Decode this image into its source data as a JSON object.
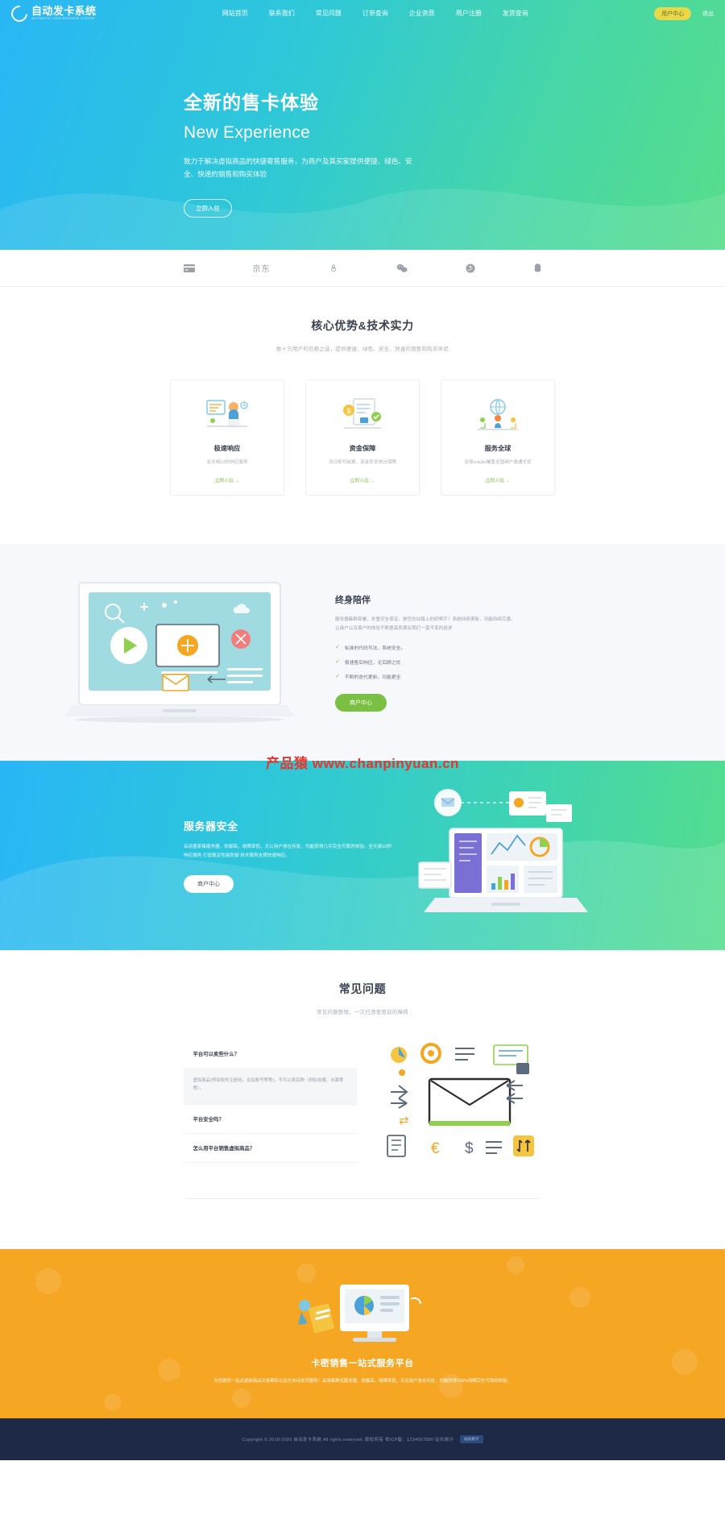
{
  "brand_colors": {
    "hero_start": "#29b6f6",
    "hero_end": "#57dd8a",
    "green": "#7ac143",
    "orange": "#f5a623",
    "footer": "#1e2a45",
    "user_btn": "#e9d84a",
    "watermark": "#e8342a"
  },
  "header": {
    "logo_title": "自动发卡系统",
    "logo_sub": "AUTOMATIC CARD BUSINESS SYSTEM",
    "nav": [
      {
        "label": "网站首页"
      },
      {
        "label": "联系我们"
      },
      {
        "label": "常见问题"
      },
      {
        "label": "订单查询"
      },
      {
        "label": "企业资质"
      },
      {
        "label": "用户注册"
      },
      {
        "label": "发货查询"
      }
    ],
    "user_center": "用户中心",
    "logout": "退出"
  },
  "hero": {
    "title_cn": "全新的售卡体验",
    "title_en": "New Experience",
    "desc": "致力于解决虚拟商品的快捷寄售服务，为商户及其买家提供便捷、绿色、安全、快速的销售和购买体验",
    "button": "立即入驻"
  },
  "brands": [
    {
      "name": "card-icon",
      "label": ""
    },
    {
      "name": "jd-logo",
      "label": "京东"
    },
    {
      "name": "taobao-icon",
      "label": ""
    },
    {
      "name": "wechat-icon",
      "label": ""
    },
    {
      "name": "alipay-icon",
      "label": ""
    },
    {
      "name": "qq-icon",
      "label": ""
    }
  ],
  "advantages": {
    "title": "核心优势&技术实力",
    "subtitle": "数十万用户的信赖之选，提供便捷、绿色、安全、快速的销售和购买体验",
    "cards": [
      {
        "title": "极速响应",
        "desc": "全天候10秒响应服务",
        "link": "立即入驻 →"
      },
      {
        "title": "资金保障",
        "desc": "次日即可结算，资金安全充分保障",
        "link": "立即入驻 →"
      },
      {
        "title": "服务全球",
        "desc": "全球ização覆盖全国用户速通无忧",
        "link": "立即入驻 →"
      }
    ]
  },
  "companion": {
    "title": "终身陪伴",
    "desc": "服务器集群部署，多重安全保证，是您创业路上的好帮手！系统持续更新，功能持续完善，让商户以及客户的体验不断提高而满足我们一直不变的追求",
    "list": [
      "标准的代码写法，系统安全。",
      "极速售后响应，无后顾之忧",
      "不断的迭代更新，功能更全"
    ],
    "button": "商户中心",
    "watermark": "产品猿 www.chanpinyuan.cn"
  },
  "server": {
    "title": "服务器安全",
    "desc": "采用墨家集服务器，防御高，故障率低，无公用户身在何处，均能获得几乎完全可靠的体验。全天候10秒响应服务 打造稳定性能防御 技术服务支撑快速响应。",
    "button": "商户中心"
  },
  "faq": {
    "title": "常见问题",
    "subtitle": "常见问题整理，一次扫清使用前的障碍",
    "items": [
      {
        "question": "平台可以卖些什么？",
        "answer": "虚拟商品(例如软件注册码，论坛账号等等)，不可以卖实物（例如衣服，水果等等）。",
        "open": true
      },
      {
        "question": "平台安全吗？",
        "answer": "",
        "open": false
      },
      {
        "question": "怎么用平台销售虚拟商品？",
        "answer": "",
        "open": false
      }
    ]
  },
  "cta": {
    "title": "卡密销售一站式服务平台",
    "desc": "为您提供一站式虚拟商品交易帮助以及全自动发货服务！采用集群式服务器，防御高，故障率低，无论用户身在何处，均能获得100%流畅完全可靠的体验。"
  },
  "footer": {
    "copyright": "Copyright © 2018-2020 自动发卡系统 All rights reserved. 版权所有 粤ICP备：1234567890 站长统计",
    "badge": "站长统计"
  }
}
